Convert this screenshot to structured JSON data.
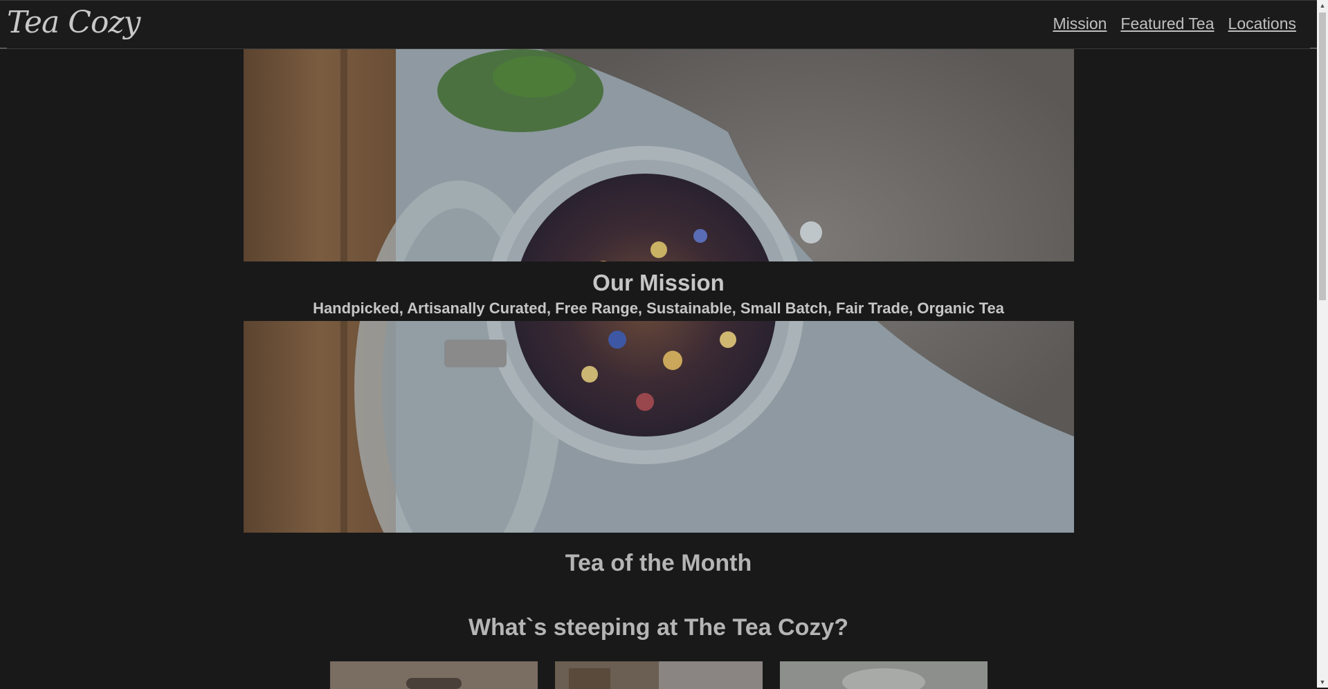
{
  "header": {
    "logo": "Tea Cozy",
    "nav": [
      "Mission",
      "Featured Tea",
      "Locations"
    ]
  },
  "mission": {
    "title": "Our Mission",
    "subtitle": "Handpicked, Artisanally Curated, Free Range, Sustainable, Small Batch, Fair Trade, Organic Tea"
  },
  "sections": {
    "tea_of_month": "Tea of the Month",
    "steeping": "What`s steeping at The Tea Cozy?"
  },
  "colors": {
    "background": "#191919",
    "text": "#c6c6c6"
  }
}
